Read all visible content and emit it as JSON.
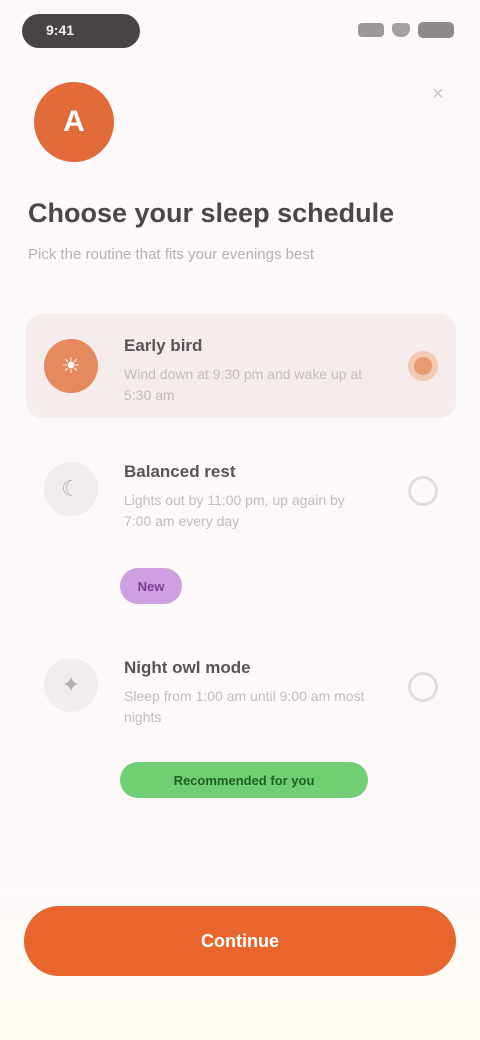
{
  "status_bar": {
    "time": "9:41"
  },
  "close_label": "×",
  "hero": {
    "initial": "A"
  },
  "title": "Choose your sleep schedule",
  "subtitle": "Pick the routine that fits your evenings best",
  "options": [
    {
      "title": "Early bird",
      "description": "Wind down at 9:30 pm and wake up at 5:30 am",
      "icon": "sun-icon",
      "selected": true
    },
    {
      "title": "Balanced rest",
      "description": "Lights out by 11:00 pm, up again by 7:00 am every day",
      "icon": "moon-icon",
      "badge": "New",
      "badge_color": "#cf9fe3",
      "selected": false
    },
    {
      "title": "Night owl mode",
      "description": "Sleep from 1:00 am until 9:00 am most nights",
      "icon": "star-icon",
      "badge": "Recommended for you",
      "badge_color": "#6fcf72",
      "selected": false
    }
  ],
  "cta": {
    "label": "Continue"
  },
  "colors": {
    "accent": "#e8652e",
    "selected_bg": "#f6ecec"
  }
}
